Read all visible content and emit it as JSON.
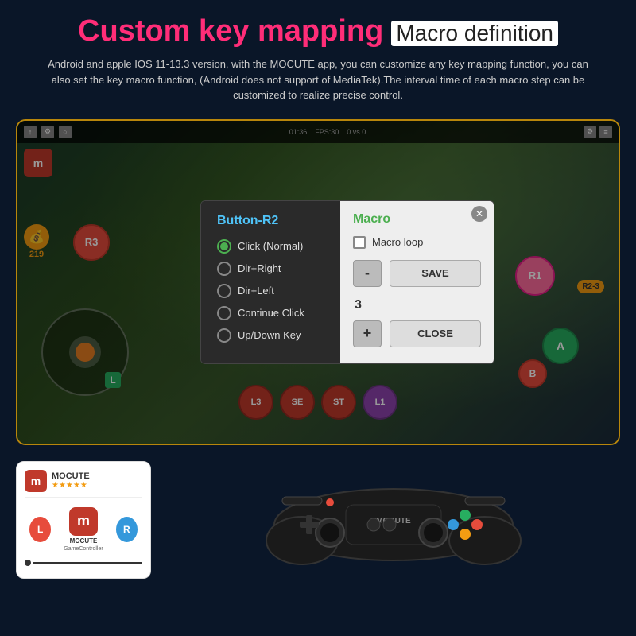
{
  "header": {
    "title_custom": "Custom key mapping",
    "title_macro": "Macro definition",
    "description": "Android and apple IOS 11-13.3 version, with the MOCUTE app, you can customize any key mapping function, you can also set the key macro function,  (Android does not support of MediaTek).The interval time of each macro step can be customized to realize precise control."
  },
  "dialog": {
    "left_title": "Button-R2",
    "options": [
      {
        "label": "Click (Normal)",
        "selected": true
      },
      {
        "label": "Dir+Right",
        "selected": false
      },
      {
        "label": "Dir+Left",
        "selected": false
      },
      {
        "label": "Continue Click",
        "selected": false
      },
      {
        "label": "Up/Down Key",
        "selected": false
      }
    ],
    "right_title": "Macro",
    "macro_loop_label": "Macro loop",
    "minus_label": "-",
    "save_label": "SAVE",
    "num_value": "3",
    "plus_label": "+",
    "close_label": "CLOSE"
  },
  "game_buttons": {
    "r3": "R3",
    "r1": "R1",
    "r2_3": "R2-3",
    "a": "A",
    "b": "B",
    "l3": "L3",
    "se": "SE",
    "st": "ST",
    "l1": "L1",
    "l_label": "L"
  },
  "app_card": {
    "name": "MOCUTE",
    "icon_letter": "m",
    "btn_r_label": "R",
    "btn_l_label": "L",
    "logo_text": "MOCUTE",
    "logo_sub": "GameController"
  },
  "topbar": {
    "time": "01:36",
    "fps": "FPS:30",
    "score": "0 vs 0"
  }
}
